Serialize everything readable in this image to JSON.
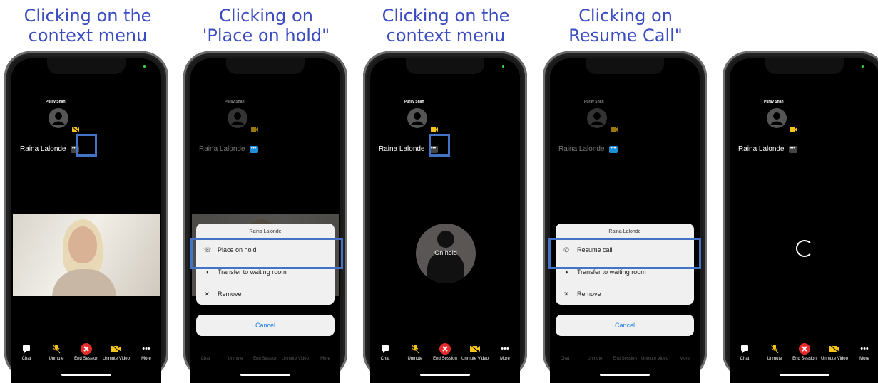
{
  "captions": [
    "Clicking on the context menu",
    "Clicking on 'Place on hold\"",
    "Clicking on the context menu",
    "Clicking on Resume Call\"",
    ""
  ],
  "participants": {
    "host": "Purav Shah",
    "guest": "Raina Lalonde"
  },
  "toolbar": {
    "chat": "Chat",
    "unmute": "Unmute",
    "end_session": "End Session",
    "unmute_video": "Unmute Video",
    "more": "More"
  },
  "sheet_hold": {
    "title": "Raina Lalonde",
    "item1": "Place on hold",
    "item2": "Transfer to waiting room",
    "item3": "Remove",
    "cancel": "Cancel"
  },
  "sheet_resume": {
    "title": "Raina Lalonde",
    "item1": "Resume call",
    "item2": "Transfer to waiting room",
    "item3": "Remove",
    "cancel": "Cancel"
  },
  "hold_label": "On hold",
  "colors": {
    "caption": "#3a4cc0",
    "highlight": "#4472c4",
    "end_red": "#e52b2b",
    "accent_blue": "#1e8fd6",
    "muted_yellow": "#f4c41a"
  }
}
